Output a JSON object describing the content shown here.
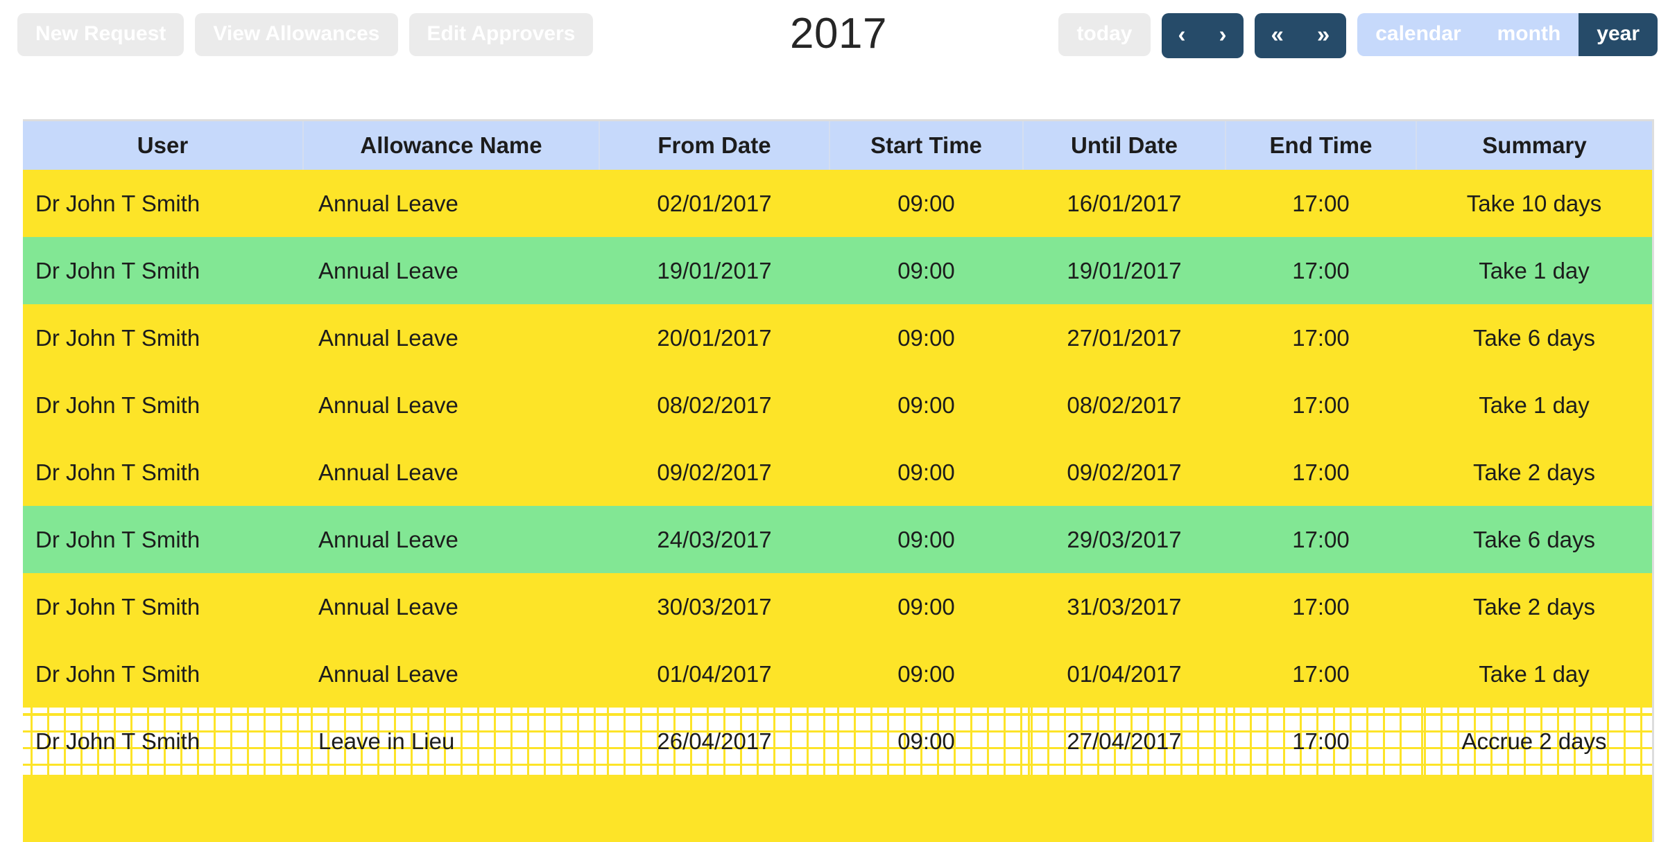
{
  "toolbar": {
    "left_buttons": [
      {
        "name": "new-request-button",
        "label": "New Request"
      },
      {
        "name": "view-allowances-button",
        "label": "View Allowances"
      },
      {
        "name": "edit-approvers-button",
        "label": "Edit Approvers"
      }
    ],
    "today_label": "today",
    "prev_label": "‹",
    "next_label": "›",
    "prev_year_label": "«",
    "next_year_label": "»",
    "views": [
      {
        "name": "view-calendar",
        "label": "calendar",
        "active": false
      },
      {
        "name": "view-month",
        "label": "month",
        "active": false
      },
      {
        "name": "view-year",
        "label": "year",
        "active": true
      }
    ],
    "colors": {
      "plain_button_bg": "#ebebeb",
      "nav_button_bg": "#264b69",
      "view_inactive_bg": "#c6d9fb",
      "view_active_bg": "#264b69"
    }
  },
  "header": {
    "title": "2017"
  },
  "table": {
    "columns": [
      "User",
      "Allowance Name",
      "From Date",
      "Start Time",
      "Until Date",
      "End Time",
      "Summary"
    ],
    "row_colors": {
      "yellow": "#fde428",
      "green": "#82e794",
      "hatched": "#ffffff",
      "header": "#c6d9fb"
    },
    "rows": [
      {
        "style": "yellow",
        "user": "Dr John T Smith",
        "allowance": "Annual Leave",
        "from_date": "02/01/2017",
        "start_time": "09:00",
        "until_date": "16/01/2017",
        "end_time": "17:00",
        "summary": "Take 10 days"
      },
      {
        "style": "green",
        "user": "Dr John T Smith",
        "allowance": "Annual Leave",
        "from_date": "19/01/2017",
        "start_time": "09:00",
        "until_date": "19/01/2017",
        "end_time": "17:00",
        "summary": "Take 1 day"
      },
      {
        "style": "yellow",
        "user": "Dr John T Smith",
        "allowance": "Annual Leave",
        "from_date": "20/01/2017",
        "start_time": "09:00",
        "until_date": "27/01/2017",
        "end_time": "17:00",
        "summary": "Take 6 days"
      },
      {
        "style": "yellow",
        "user": "Dr John T Smith",
        "allowance": "Annual Leave",
        "from_date": "08/02/2017",
        "start_time": "09:00",
        "until_date": "08/02/2017",
        "end_time": "17:00",
        "summary": "Take 1 day"
      },
      {
        "style": "yellow",
        "user": "Dr John T Smith",
        "allowance": "Annual Leave",
        "from_date": "09/02/2017",
        "start_time": "09:00",
        "until_date": "09/02/2017",
        "end_time": "17:00",
        "summary": "Take 2 days"
      },
      {
        "style": "green",
        "user": "Dr John T Smith",
        "allowance": "Annual Leave",
        "from_date": "24/03/2017",
        "start_time": "09:00",
        "until_date": "29/03/2017",
        "end_time": "17:00",
        "summary": "Take 6 days"
      },
      {
        "style": "yellow",
        "user": "Dr John T Smith",
        "allowance": "Annual Leave",
        "from_date": "30/03/2017",
        "start_time": "09:00",
        "until_date": "31/03/2017",
        "end_time": "17:00",
        "summary": "Take 2 days"
      },
      {
        "style": "yellow",
        "user": "Dr John T Smith",
        "allowance": "Annual Leave",
        "from_date": "01/04/2017",
        "start_time": "09:00",
        "until_date": "01/04/2017",
        "end_time": "17:00",
        "summary": "Take 1 day"
      },
      {
        "style": "hatch",
        "user": "Dr John T Smith",
        "allowance": "Leave in Lieu",
        "from_date": "26/04/2017",
        "start_time": "09:00",
        "until_date": "27/04/2017",
        "end_time": "17:00",
        "summary": "Accrue 2 days"
      },
      {
        "style": "yellow",
        "user": "",
        "allowance": "",
        "from_date": "",
        "start_time": "",
        "until_date": "",
        "end_time": "",
        "summary": ""
      }
    ]
  }
}
